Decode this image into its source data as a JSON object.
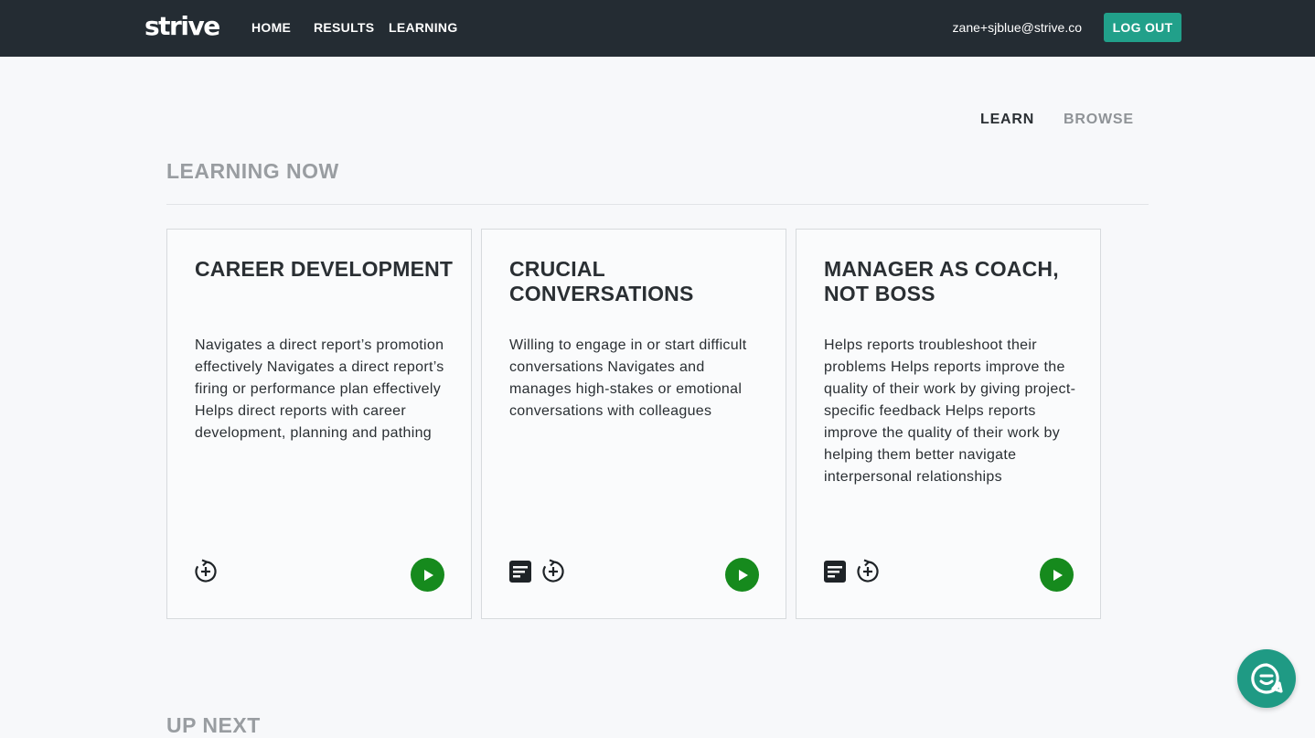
{
  "header": {
    "logo": "strive",
    "nav": [
      "HOME",
      "RESULTS",
      "LEARNING"
    ],
    "user_email": "zane+sjblue@strive.co",
    "logout_label": "LOG OUT"
  },
  "view_tabs": {
    "learn": "LEARN",
    "browse": "BROWSE"
  },
  "section_title": "LEARNING NOW",
  "cards": [
    {
      "title": "CAREER DEVELOPMENT",
      "description": "Navigates a direct report’s promotion effectively Navigates a direct report’s firing or performance plan effectively Helps direct reports with career development, planning and pathing",
      "icons": [
        "add-progress-icon"
      ]
    },
    {
      "title": "CRUCIAL CONVERSATIONS",
      "description": "Willing to engage in or start difficult conversations Navigates and manages high-stakes or emotional conversations with colleagues",
      "icons": [
        "document-icon",
        "add-progress-icon"
      ]
    },
    {
      "title": "MANAGER AS COACH, NOT BOSS",
      "description": "Helps reports troubleshoot their problems Helps reports improve the quality of their work by giving project-specific feedback Helps reports improve the quality of their work by helping them better navigate interpersonal relationships",
      "icons": [
        "document-icon",
        "add-progress-icon"
      ]
    }
  ],
  "next_section_title": "UP NEXT",
  "colors": {
    "topbar": "#242c33",
    "accent": "#21a08a",
    "play": "#168a1d"
  }
}
